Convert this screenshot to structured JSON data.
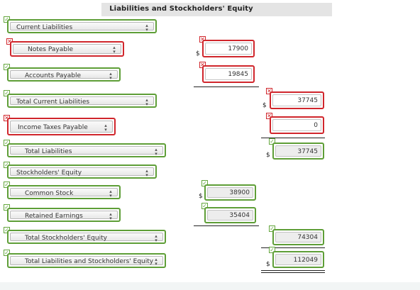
{
  "header": {
    "title": "Liabilities and Stockholders' Equity"
  },
  "currency_symbol": "$",
  "marks": {
    "correct": "✓",
    "incorrect": "✕"
  },
  "colors": {
    "correct": "#5e9e37",
    "incorrect": "#d0262c"
  },
  "rows": {
    "current_liabilities": {
      "label": "Current Liabilities",
      "status": "correct"
    },
    "notes_payable": {
      "label": "Notes Payable",
      "status": "incorrect",
      "amount": "17900",
      "amount_status": "incorrect"
    },
    "accounts_payable": {
      "label": "Accounts Payable",
      "status": "correct",
      "amount": "19845",
      "amount_status": "incorrect"
    },
    "total_current_liabilities": {
      "label": "Total Current Liabilities",
      "status": "correct",
      "amount": "37745",
      "amount_status": "incorrect"
    },
    "income_taxes_payable": {
      "label": "Income Taxes Payable",
      "status": "incorrect",
      "amount": "0",
      "amount_status": "incorrect"
    },
    "total_liabilities": {
      "label": "Total Liabilities",
      "status": "correct",
      "amount": "37745",
      "amount_status": "correct"
    },
    "stockholders_equity": {
      "label": "Stockholders' Equity",
      "status": "correct"
    },
    "common_stock": {
      "label": "Common Stock",
      "status": "correct",
      "amount": "38900",
      "amount_status": "correct"
    },
    "retained_earnings": {
      "label": "Retained Earnings",
      "status": "correct",
      "amount": "35404",
      "amount_status": "correct"
    },
    "total_stockholders_equity": {
      "label": "Total Stockholders' Equity",
      "status": "correct",
      "amount": "74304",
      "amount_status": "correct"
    },
    "total_liabilities_and_equity": {
      "label": "Total Liabilities and Stockholders' Equity",
      "status": "correct",
      "amount": "112049",
      "amount_status": "correct"
    }
  }
}
